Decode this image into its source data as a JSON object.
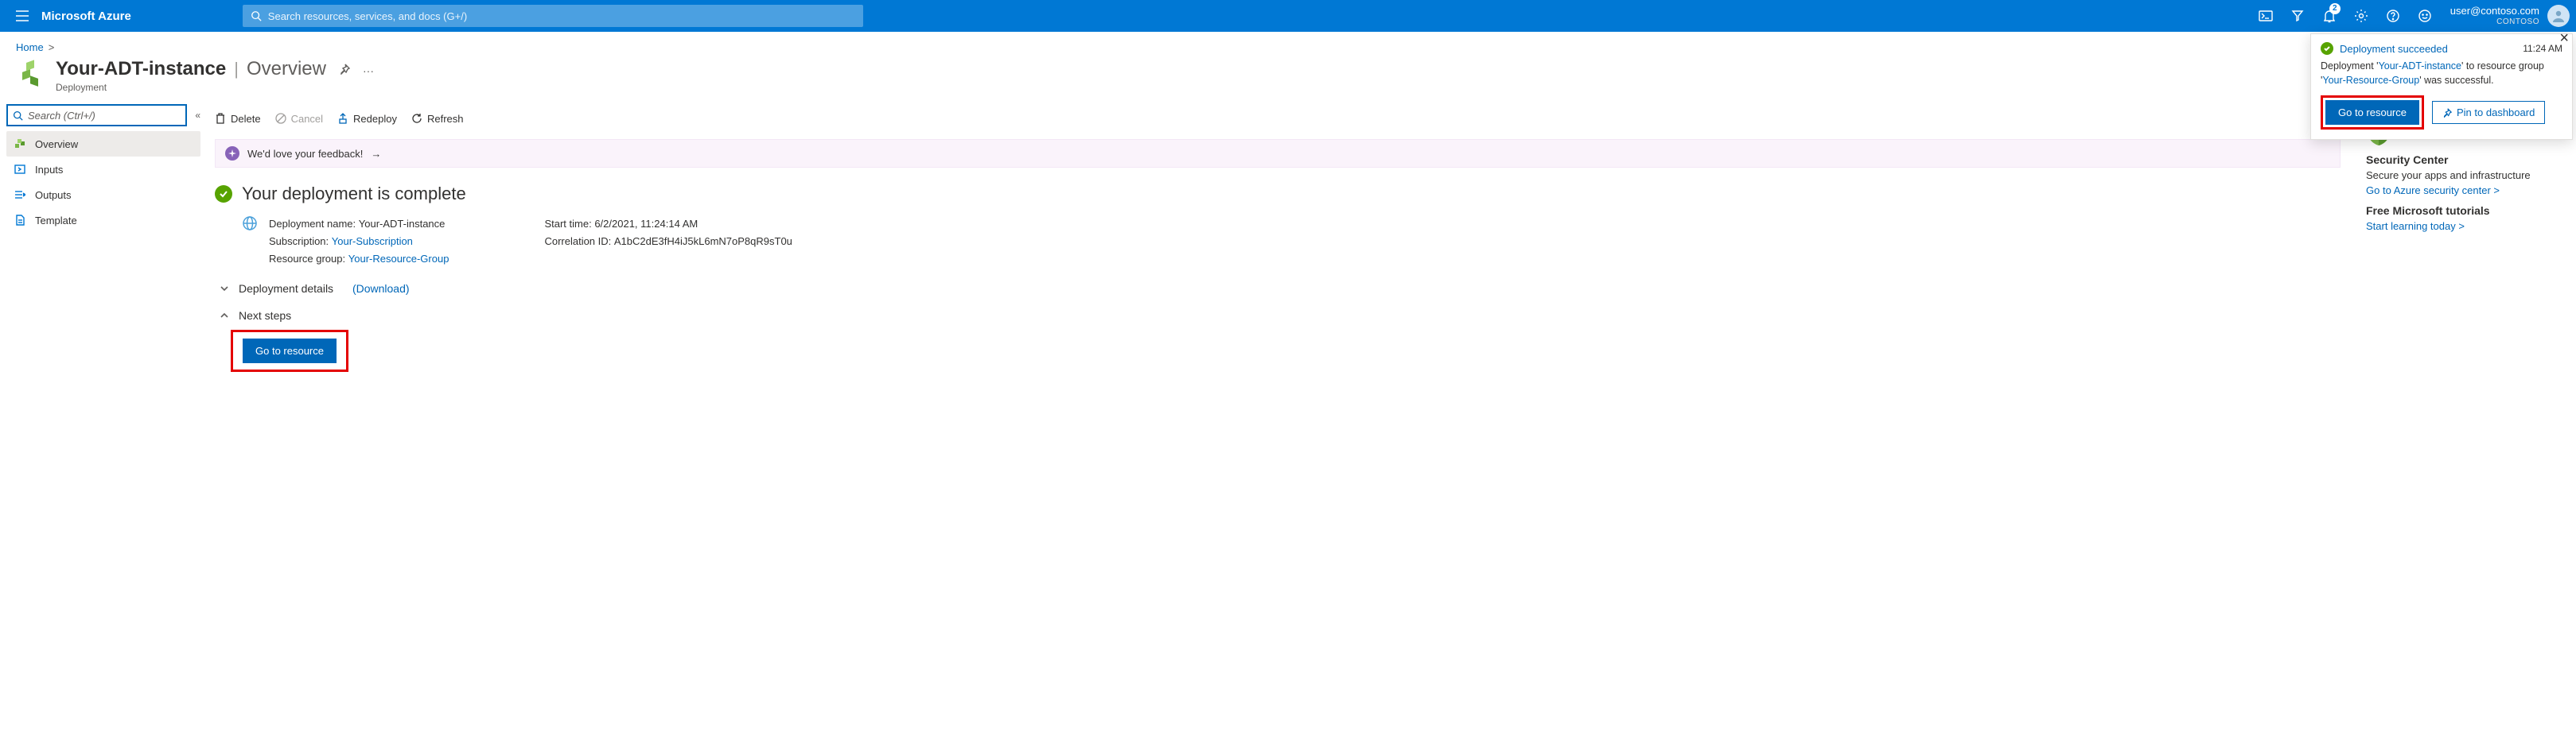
{
  "topbar": {
    "brand": "Microsoft Azure",
    "search_placeholder": "Search resources, services, and docs (G+/)",
    "notification_count": "2",
    "account_email": "user@contoso.com",
    "account_org": "CONTOSO"
  },
  "breadcrumb": {
    "home": "Home"
  },
  "header": {
    "resource_name": "Your-ADT-instance",
    "section": "Overview",
    "subtitle": "Deployment"
  },
  "sidebar": {
    "search_placeholder": "Search (Ctrl+/)",
    "items": [
      {
        "label": "Overview",
        "active": true
      },
      {
        "label": "Inputs"
      },
      {
        "label": "Outputs"
      },
      {
        "label": "Template"
      }
    ]
  },
  "cmdbar": {
    "delete": "Delete",
    "cancel": "Cancel",
    "redeploy": "Redeploy",
    "refresh": "Refresh"
  },
  "feedback": {
    "text": "We'd love your feedback!"
  },
  "status": {
    "message": "Your deployment is complete"
  },
  "details": {
    "deployment_name_label": "Deployment name:",
    "deployment_name": "Your-ADT-instance",
    "subscription_label": "Subscription:",
    "subscription": "Your-Subscription",
    "resource_group_label": "Resource group:",
    "resource_group": "Your-Resource-Group",
    "start_time_label": "Start time:",
    "start_time": "6/2/2021, 11:24:14 AM",
    "correlation_label": "Correlation ID:",
    "correlation_id": "A1bC2dE3fH4iJ5kL6mN7oP8qR9sT0u"
  },
  "sections": {
    "deployment_details": "Deployment details",
    "download": "(Download)",
    "next_steps": "Next steps"
  },
  "buttons": {
    "go_to_resource": "Go to resource"
  },
  "right": {
    "sc_title": "Security Center",
    "sc_desc": "Secure your apps and infrastructure",
    "sc_link": "Go to Azure security center >",
    "tut_title": "Free Microsoft tutorials",
    "tut_link": "Start learning today >"
  },
  "toast": {
    "title": "Deployment succeeded",
    "time": "11:24 AM",
    "pre": "Deployment '",
    "dep_name": "Your-ADT-instance",
    "mid": "' to resource group '",
    "rg_name": "Your-Resource-Group",
    "post": "' was successful.",
    "go": "Go to resource",
    "pin": "Pin to dashboard"
  }
}
